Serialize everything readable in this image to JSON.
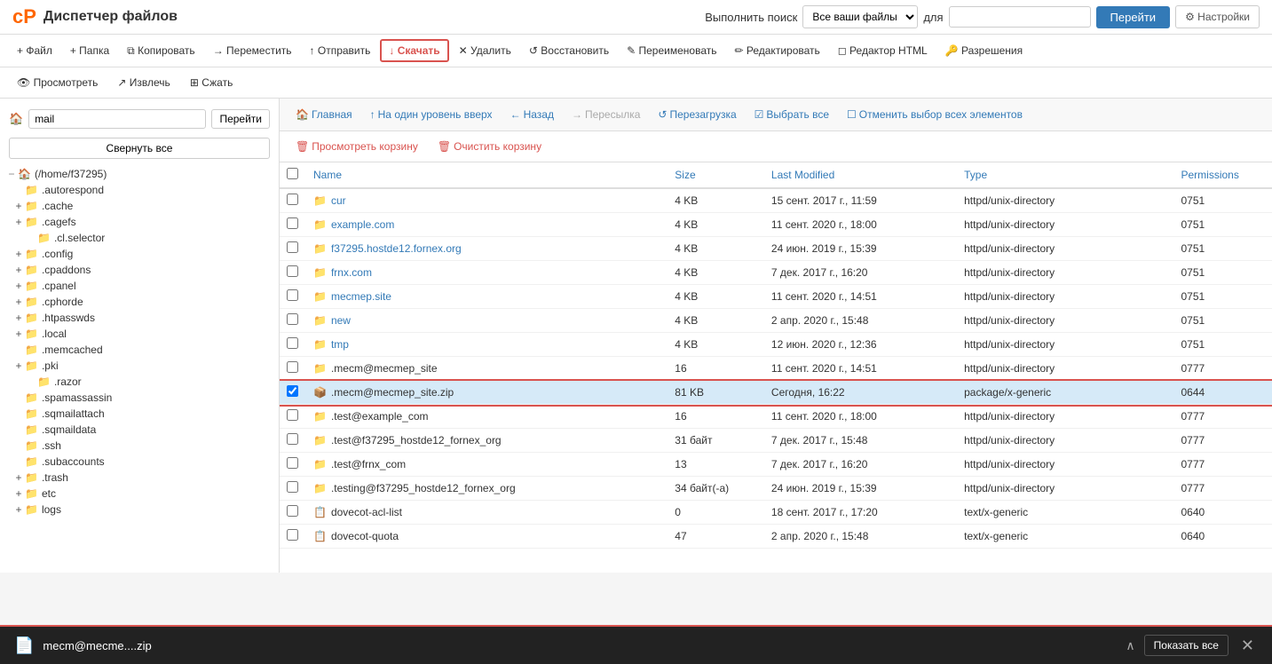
{
  "app": {
    "title": "Диспетчер файлов",
    "logo_symbol": "cP"
  },
  "header": {
    "search_label": "Выполнить поиск",
    "search_select_default": "Все ваши файлы",
    "search_for_label": "для",
    "search_placeholder": "",
    "btn_go": "Перейти",
    "btn_settings": "⚙ Настройки"
  },
  "toolbar": {
    "file_btn": "+ Файл",
    "folder_btn": "+ Папка",
    "copy_btn": "⧉ Копировать",
    "move_btn": "→ Переместить",
    "upload_btn": "↑ Отправить",
    "download_btn": "↓ Скачать",
    "delete_btn": "✕ Удалить",
    "restore_btn": "↺ Восстановить",
    "rename_btn": "✎ Переименовать",
    "edit_btn": "✏ Редактировать",
    "html_editor_btn": "◻ Редактор HTML",
    "permissions_btn": "🔑 Разрешения"
  },
  "toolbar2": {
    "view_btn": "👁 Просмотреть",
    "extract_btn": "↗ Извлечь",
    "compress_btn": "⊞ Сжать"
  },
  "sidebar": {
    "path_value": "mail",
    "path_go_btn": "Перейти",
    "collapse_btn": "Свернуть все",
    "tree": [
      {
        "id": "root",
        "label": "⌂ (/home/f37295)",
        "indent": 0,
        "expanded": true,
        "icon": "home"
      },
      {
        "id": "autorespond",
        "label": ".autorespond",
        "indent": 1,
        "expanded": false,
        "icon": "folder"
      },
      {
        "id": "cache",
        "label": ".cache",
        "indent": 1,
        "expanded": false,
        "icon": "folder",
        "has_toggle": true
      },
      {
        "id": "cagefs",
        "label": ".cagefs",
        "indent": 1,
        "expanded": false,
        "icon": "folder",
        "has_toggle": true
      },
      {
        "id": "cl_selector",
        "label": ".cl.selector",
        "indent": 2,
        "expanded": false,
        "icon": "folder"
      },
      {
        "id": "config",
        "label": ".config",
        "indent": 1,
        "expanded": false,
        "icon": "folder",
        "has_toggle": true
      },
      {
        "id": "cpaddons",
        "label": ".cpaddons",
        "indent": 1,
        "expanded": false,
        "icon": "folder",
        "has_toggle": true
      },
      {
        "id": "cpanel",
        "label": ".cpanel",
        "indent": 1,
        "expanded": false,
        "icon": "folder",
        "has_toggle": true
      },
      {
        "id": "cphorde",
        "label": ".cphorde",
        "indent": 1,
        "expanded": false,
        "icon": "folder",
        "has_toggle": true
      },
      {
        "id": "htpasswds",
        "label": ".htpasswds",
        "indent": 1,
        "expanded": false,
        "icon": "folder",
        "has_toggle": true
      },
      {
        "id": "local",
        "label": ".local",
        "indent": 1,
        "expanded": false,
        "icon": "folder",
        "has_toggle": true
      },
      {
        "id": "memcached",
        "label": ".memcached",
        "indent": 1,
        "expanded": false,
        "icon": "folder"
      },
      {
        "id": "pki",
        "label": ".pki",
        "indent": 1,
        "expanded": false,
        "icon": "folder",
        "has_toggle": true
      },
      {
        "id": "razor",
        "label": ".razor",
        "indent": 2,
        "expanded": false,
        "icon": "folder"
      },
      {
        "id": "spamassassin",
        "label": ".spamassassin",
        "indent": 1,
        "expanded": false,
        "icon": "folder"
      },
      {
        "id": "sqmailattach",
        "label": ".sqmailattach",
        "indent": 1,
        "expanded": false,
        "icon": "folder"
      },
      {
        "id": "sqmaildata",
        "label": ".sqmaildata",
        "indent": 1,
        "expanded": false,
        "icon": "folder"
      },
      {
        "id": "ssh",
        "label": ".ssh",
        "indent": 1,
        "expanded": false,
        "icon": "folder"
      },
      {
        "id": "subaccounts",
        "label": ".subaccounts",
        "indent": 1,
        "expanded": false,
        "icon": "folder"
      },
      {
        "id": "trash",
        "label": ".trash",
        "indent": 1,
        "expanded": false,
        "icon": "folder",
        "has_toggle": true
      },
      {
        "id": "etc",
        "label": "etc",
        "indent": 1,
        "expanded": false,
        "icon": "folder",
        "has_toggle": true
      },
      {
        "id": "logs",
        "label": "logs",
        "indent": 1,
        "expanded": false,
        "icon": "folder",
        "has_toggle": true
      }
    ]
  },
  "file_nav": {
    "home_btn": "Главная",
    "up_btn": "На один уровень вверх",
    "back_btn": "Назад",
    "forward_btn": "Пересылка",
    "reload_btn": "Перезагрузка",
    "select_all_btn": "Выбрать все",
    "deselect_btn": "Отменить выбор всех элементов"
  },
  "basket_nav": {
    "view_basket_btn": "Просмотреть корзину",
    "clear_basket_btn": "Очистить корзину"
  },
  "table": {
    "headers": {
      "name": "Name",
      "size": "Size",
      "last_modified": "Last Modified",
      "type": "Type",
      "permissions": "Permissions"
    },
    "rows": [
      {
        "id": 1,
        "name": "cur",
        "size": "4 KB",
        "modified": "15 сент. 2017 г., 11:59",
        "type": "httpd/unix-directory",
        "perms": "0751",
        "is_folder": true,
        "is_file": false,
        "selected": false
      },
      {
        "id": 2,
        "name": "example.com",
        "size": "4 KB",
        "modified": "11 сент. 2020 г., 18:00",
        "type": "httpd/unix-directory",
        "perms": "0751",
        "is_folder": true,
        "is_file": false,
        "selected": false
      },
      {
        "id": 3,
        "name": "f37295.hostde12.fornex.org",
        "size": "4 KB",
        "modified": "24 июн. 2019 г., 15:39",
        "type": "httpd/unix-directory",
        "perms": "0751",
        "is_folder": true,
        "is_file": false,
        "selected": false
      },
      {
        "id": 4,
        "name": "frnx.com",
        "size": "4 KB",
        "modified": "7 дек. 2017 г., 16:20",
        "type": "httpd/unix-directory",
        "perms": "0751",
        "is_folder": true,
        "is_file": false,
        "selected": false
      },
      {
        "id": 5,
        "name": "mecmep.site",
        "size": "4 KB",
        "modified": "11 сент. 2020 г., 14:51",
        "type": "httpd/unix-directory",
        "perms": "0751",
        "is_folder": true,
        "is_file": false,
        "selected": false
      },
      {
        "id": 6,
        "name": "new",
        "size": "4 KB",
        "modified": "2 апр. 2020 г., 15:48",
        "type": "httpd/unix-directory",
        "perms": "0751",
        "is_folder": true,
        "is_file": false,
        "selected": false
      },
      {
        "id": 7,
        "name": "tmp",
        "size": "4 KB",
        "modified": "12 июн. 2020 г., 12:36",
        "type": "httpd/unix-directory",
        "perms": "0751",
        "is_folder": true,
        "is_file": false,
        "selected": false
      },
      {
        "id": 8,
        "name": ".mecm@mecmep_site",
        "size": "16",
        "modified": "11 сент. 2020 г., 14:51",
        "type": "httpd/unix-directory",
        "perms": "0777",
        "is_folder": false,
        "is_special": true,
        "selected": false
      },
      {
        "id": 9,
        "name": ".mecm@mecmep_site.zip",
        "size": "81 KB",
        "modified": "Сегодня, 16:22",
        "type": "package/x-generic",
        "perms": "0644",
        "is_folder": false,
        "is_zip": true,
        "selected": true
      },
      {
        "id": 10,
        "name": ".test@example_com",
        "size": "16",
        "modified": "11 сент. 2020 г., 18:00",
        "type": "httpd/unix-directory",
        "perms": "0777",
        "is_folder": false,
        "is_special": true,
        "selected": false
      },
      {
        "id": 11,
        "name": ".test@f37295_hostde12_fornex_org",
        "size": "31 байт",
        "modified": "7 дек. 2017 г., 15:48",
        "type": "httpd/unix-directory",
        "perms": "0777",
        "is_folder": false,
        "is_special": true,
        "selected": false
      },
      {
        "id": 12,
        "name": ".test@frnx_com",
        "size": "13",
        "modified": "7 дек. 2017 г., 16:20",
        "type": "httpd/unix-directory",
        "perms": "0777",
        "is_folder": false,
        "is_special": true,
        "selected": false
      },
      {
        "id": 13,
        "name": ".testing@f37295_hostde12_fornex_org",
        "size": "34 байт(-а)",
        "modified": "24 июн. 2019 г., 15:39",
        "type": "httpd/unix-directory",
        "perms": "0777",
        "is_folder": false,
        "is_special": true,
        "selected": false
      },
      {
        "id": 14,
        "name": "dovecot-acl-list",
        "size": "0",
        "modified": "18 сент. 2017 г., 17:20",
        "type": "text/x-generic",
        "perms": "0640",
        "is_folder": false,
        "is_text": true,
        "selected": false
      },
      {
        "id": 15,
        "name": "dovecot-quota",
        "size": "47",
        "modified": "2 апр. 2020 г., 15:48",
        "type": "text/x-generic",
        "perms": "0640",
        "is_folder": false,
        "is_text": true,
        "selected": false
      }
    ]
  },
  "download_bar": {
    "filename": "mecm@mecme....zip",
    "chevron": "∧",
    "show_all_btn": "Показать все",
    "close_btn": "✕"
  }
}
